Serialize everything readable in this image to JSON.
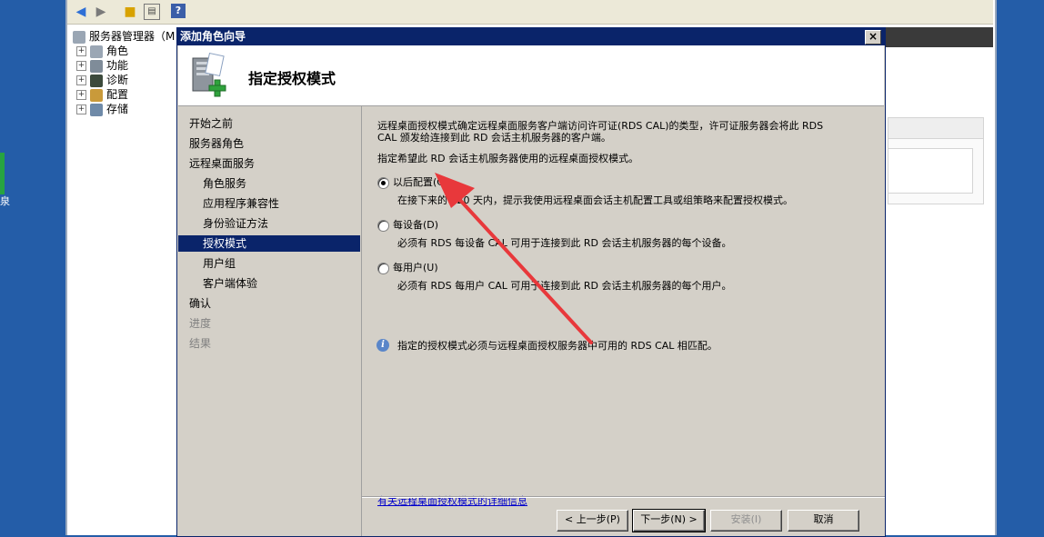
{
  "server_manager": {
    "tree": [
      {
        "label": "服务器管理器（M",
        "expander": ""
      },
      {
        "label": "角色",
        "expander": "+"
      },
      {
        "label": "功能",
        "expander": "+"
      },
      {
        "label": "诊断",
        "expander": "+"
      },
      {
        "label": "配置",
        "expander": "+"
      },
      {
        "label": "存储",
        "expander": "+"
      }
    ],
    "edge_char": "泉"
  },
  "wizard": {
    "title": "添加角色向导",
    "close_label": "×",
    "header_title": "指定授权模式",
    "nav": [
      {
        "label": "开始之前"
      },
      {
        "label": "服务器角色"
      },
      {
        "label": "远程桌面服务"
      },
      {
        "label": "角色服务"
      },
      {
        "label": "应用程序兼容性"
      },
      {
        "label": "身份验证方法"
      },
      {
        "label": "授权模式"
      },
      {
        "label": "用户组"
      },
      {
        "label": "客户端体验"
      },
      {
        "label": "确认"
      },
      {
        "label": "进度"
      },
      {
        "label": "结果"
      }
    ],
    "content": {
      "intro_line1": "远程桌面授权模式确定远程桌面服务客户端访问许可证(RDS CAL)的类型，许可证服务器会将此 RDS",
      "intro_line2": "CAL 颁发给连接到此 RD 会话主机服务器的客户端。",
      "prompt": "指定希望此 RD 会话主机服务器使用的远程桌面授权模式。",
      "options": [
        {
          "label": "以后配置(C)",
          "desc": "在接下来的 120 天内，提示我使用远程桌面会话主机配置工具或组策略来配置授权模式。",
          "checked": true
        },
        {
          "label": "每设备(D)",
          "desc": "必须有 RDS 每设备 CAL 可用于连接到此 RD 会话主机服务器的每个设备。",
          "checked": false
        },
        {
          "label": "每用户(U)",
          "desc": "必须有 RDS 每用户 CAL 可用于连接到此 RD 会话主机服务器的每个用户。",
          "checked": false
        }
      ],
      "info_text": "指定的授权模式必须与远程桌面授权服务器中可用的 RDS CAL 相匹配。",
      "info_icon": "i",
      "help_link": "有关远程桌面授权模式的详细信息"
    },
    "buttons": {
      "back": "< 上一步(P)",
      "next": "下一步(N) >",
      "install": "安装(I)",
      "cancel": "取消"
    }
  },
  "colors": {
    "title_bar": "#0a246a",
    "dialog_face": "#d4d0c8",
    "annotation_arrow": "#e8383b"
  }
}
